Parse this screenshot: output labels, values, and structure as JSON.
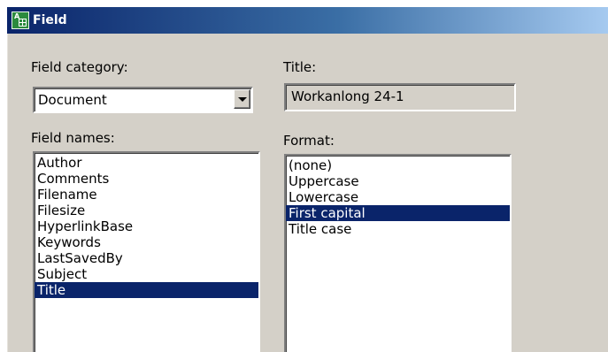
{
  "window": {
    "title": "Field"
  },
  "field_category": {
    "label": "Field category:",
    "value": "Document"
  },
  "title_field": {
    "label": "Title:",
    "value": "Workanlong 24-1"
  },
  "field_names": {
    "label": "Field names:",
    "items": [
      "Author",
      "Comments",
      "Filename",
      "Filesize",
      "HyperlinkBase",
      "Keywords",
      "LastSavedBy",
      "Subject",
      "Title"
    ],
    "selected": 8
  },
  "format": {
    "label": "Format:",
    "items": [
      "(none)",
      "Uppercase",
      "Lowercase",
      "First capital",
      "Title case"
    ],
    "selected": 3
  },
  "colors": {
    "selection": "#0a246a",
    "dialog_face": "#d4d0c8"
  }
}
